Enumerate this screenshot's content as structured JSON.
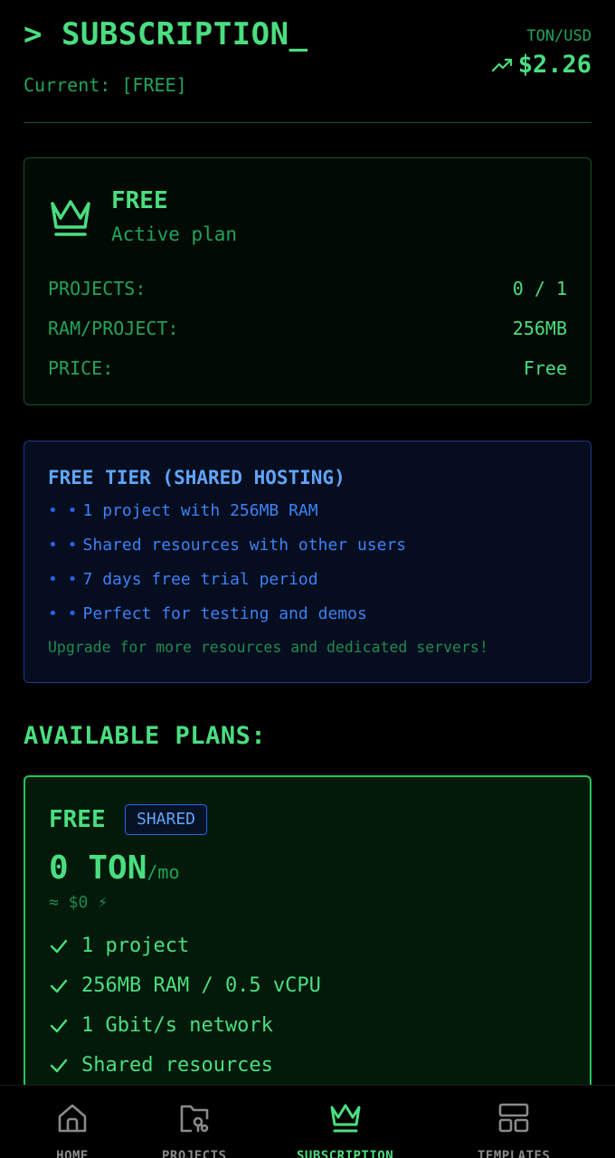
{
  "header": {
    "title": "> SUBSCRIPTION_",
    "current": "Current: [FREE]",
    "rate_label": "TON/USD",
    "rate_value": "$2.26",
    "rate_icon": "trending-up-icon"
  },
  "current_plan": {
    "icon": "crown-icon",
    "name": "FREE",
    "subtitle": "Active plan",
    "rows": [
      {
        "label": "PROJECTS:",
        "value": "0 / 1"
      },
      {
        "label": "RAM/PROJECT:",
        "value": "256MB"
      },
      {
        "label": "PRICE:",
        "value": "Free"
      }
    ]
  },
  "info": {
    "title": "FREE TIER (SHARED HOSTING)",
    "bullets": [
      {
        "dots": "• •",
        "text": "1 project with 256MB RAM"
      },
      {
        "dots": "• •",
        "text": "Shared resources with other users"
      },
      {
        "dots": "• •",
        "text": "7 days free trial period"
      },
      {
        "dots": "• •",
        "text": "Perfect for testing and demos"
      }
    ],
    "note": "Upgrade for more resources and dedicated servers!"
  },
  "plans_title": "AVAILABLE PLANS:",
  "plan": {
    "name": "FREE",
    "badge": "SHARED",
    "price": "0 TON",
    "per": "/mo",
    "usd": "≈ $0 ⚡",
    "features": [
      "1 project",
      "256MB RAM / 0.5 vCPU",
      "1 Gbit/s network",
      "Shared resources"
    ]
  },
  "nav": {
    "items": [
      {
        "label": "HOME",
        "icon": "home-icon"
      },
      {
        "label": "PROJECTS",
        "icon": "projects-folder-icon"
      },
      {
        "label": "SUBSCRIPTION",
        "icon": "crown-icon"
      },
      {
        "label": "TEMPLATES",
        "icon": "templates-icon"
      }
    ],
    "active": "SUBSCRIPTION"
  },
  "colors": {
    "background": "#000000",
    "accent_green": "#4ade80",
    "dim_green": "#22a35a",
    "accent_blue": "#60a5fa",
    "nav_inactive": "#8a8a8a"
  }
}
